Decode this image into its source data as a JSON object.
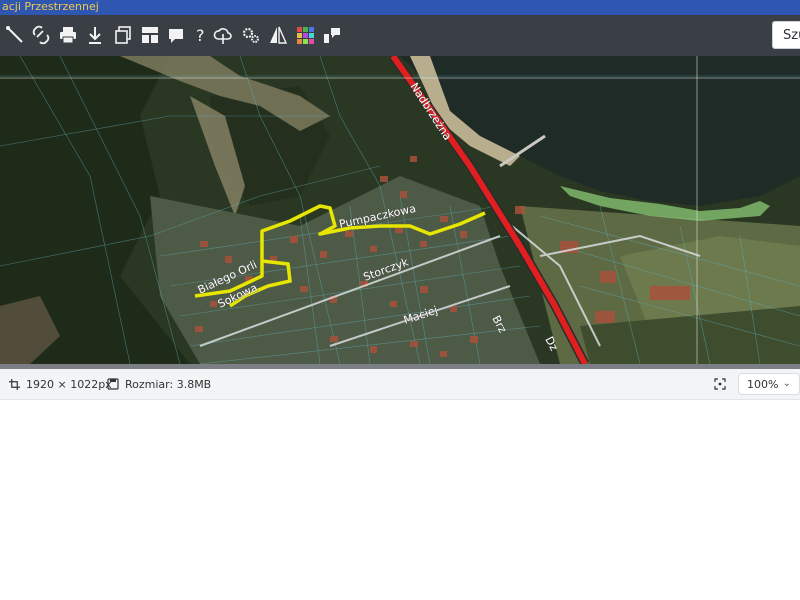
{
  "window": {
    "title": "acji Przestrzennej"
  },
  "toolbar": {
    "tools": [
      {
        "icon": "measure-line-icon"
      },
      {
        "icon": "link-icon"
      },
      {
        "icon": "print-icon"
      },
      {
        "icon": "download-icon"
      },
      {
        "icon": "copy-icon"
      },
      {
        "icon": "layout-icon"
      },
      {
        "icon": "speech-bubble-icon"
      },
      {
        "icon": "help-icon"
      },
      {
        "icon": "cloud-upload-icon"
      },
      {
        "icon": "settings-icon"
      },
      {
        "icon": "compare-icon"
      },
      {
        "icon": "color-grid-icon"
      },
      {
        "icon": "chat-icon"
      }
    ],
    "search_label": "Szu"
  },
  "map": {
    "streets": [
      {
        "key": "nadbrzezna",
        "text": "Nadbrzeżna"
      },
      {
        "key": "pumpaczkowa",
        "text": "Pumpaczkowa"
      },
      {
        "key": "storczyk",
        "text": "Storczyk"
      },
      {
        "key": "maciej",
        "text": "Maciej"
      },
      {
        "key": "bialego",
        "text": "Białego Orli"
      },
      {
        "key": "sokowa",
        "text": "Sokowa"
      },
      {
        "key": "brz",
        "text": "Brz"
      },
      {
        "key": "dz",
        "text": "Dz"
      }
    ],
    "colors": {
      "main_road": "#e02020",
      "highlight_route": "#e6e600",
      "water": "#1f2b26",
      "forest": "#26331e"
    }
  },
  "status": {
    "dimensions": "1920 × 1022px",
    "size": "Rozmiar: 3.8MB",
    "zoom": "100%"
  }
}
